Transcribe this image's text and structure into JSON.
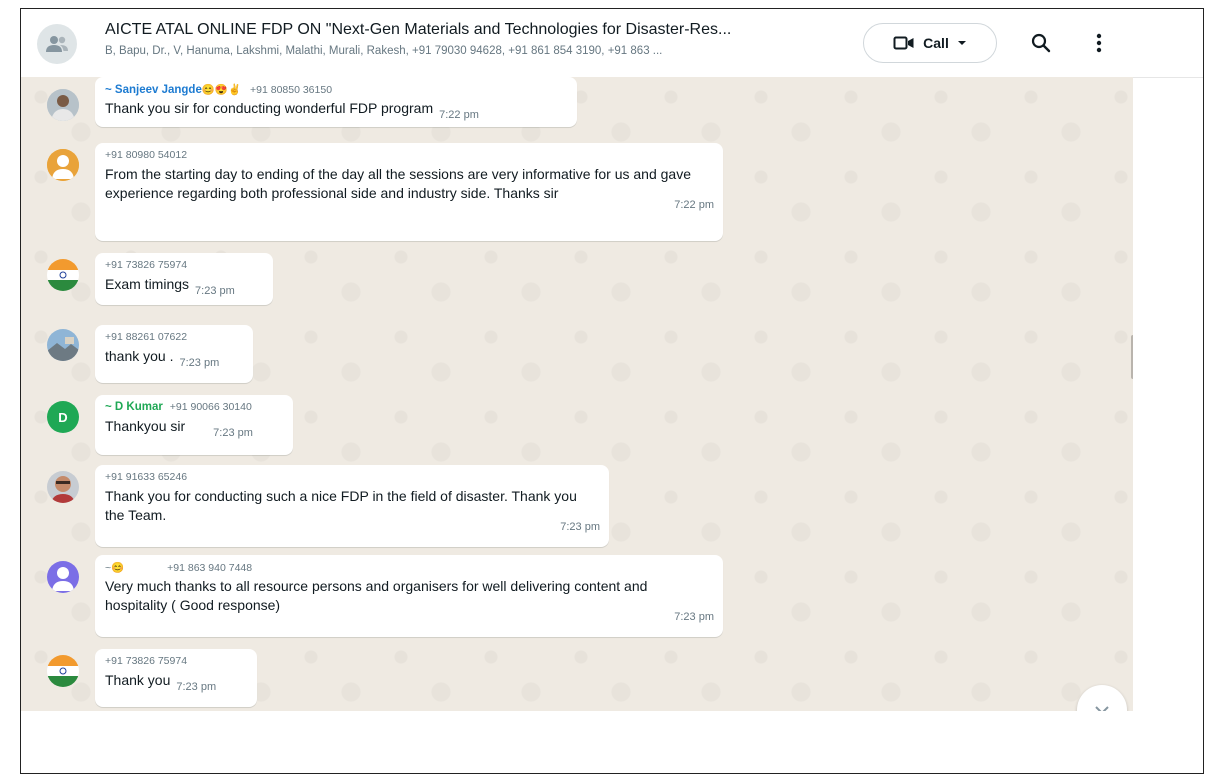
{
  "header": {
    "title": "AICTE ATAL ONLINE FDP ON \"Next-Gen Materials and Technologies for Disaster-Res...",
    "participants": "B, Bapu, Dr., V, Hanuma, Lakshmi, Malathi, Murali, Rakesh, +91 79030 94628, +91 861 854 3190, +91 863 ...",
    "call_label": "Call",
    "icons": [
      "group-icon",
      "video-call-icon",
      "chevron-down-icon",
      "search-icon",
      "more-vertical-icon"
    ]
  },
  "messages": [
    {
      "sender_name": "~ Sanjeev Jangde",
      "sender_emoji": "😊😍✌",
      "sender_phone": "+91 80850 36150",
      "name_color": "#1d7bd1",
      "text": "Thank you sir for conducting wonderful  FDP program",
      "time": "7:22 pm",
      "avatar": "photo"
    },
    {
      "sender_name": "",
      "sender_emoji": "",
      "sender_phone": "+91 80980 54012",
      "name_color": "",
      "text": "From the starting day to ending of the day all the sessions are very informative for us and gave experience regarding both professional side and industry side. Thanks sir",
      "time": "7:22 pm",
      "avatar": "default"
    },
    {
      "sender_name": "",
      "sender_emoji": "",
      "sender_phone": "+91 73826 75974",
      "name_color": "",
      "text": "Exam timings",
      "time": "7:23 pm",
      "avatar": "flag"
    },
    {
      "sender_name": "",
      "sender_emoji": "",
      "sender_phone": "+91 88261 07622",
      "name_color": "",
      "text": "thank you .",
      "time": "7:23 pm",
      "avatar": "landscape"
    },
    {
      "sender_name": "~ D Kumar",
      "sender_emoji": "",
      "sender_phone": "+91 90066 30140",
      "name_color": "#1fa855",
      "text": "Thankyou sir",
      "time": "7:23 pm",
      "avatar": "letter",
      "avatar_letter": "D"
    },
    {
      "sender_name": "",
      "sender_emoji": "",
      "sender_phone": "+91 91633 65246",
      "name_color": "",
      "text": "Thank you for conducting such a nice FDP in the field of disaster. Thank you the Team.",
      "time": "7:23 pm",
      "avatar": "photo2"
    },
    {
      "sender_name": "~",
      "sender_emoji": "😊",
      "sender_phone": "+91 863 940 7448",
      "name_color": "#667781",
      "text": "Very much thanks to all resource persons and organisers for well delivering content and hospitality ( Good response)",
      "time": "7:23 pm",
      "avatar": "purple"
    },
    {
      "sender_name": "",
      "sender_emoji": "",
      "sender_phone": "+91 73826 75974",
      "name_color": "",
      "text": "Thank you",
      "time": "7:23 pm",
      "avatar": "flag"
    }
  ],
  "colors": {
    "chat_bg": "#efeae2",
    "bubble_bg": "#ffffff",
    "text": "#111b21",
    "meta": "#667781"
  }
}
